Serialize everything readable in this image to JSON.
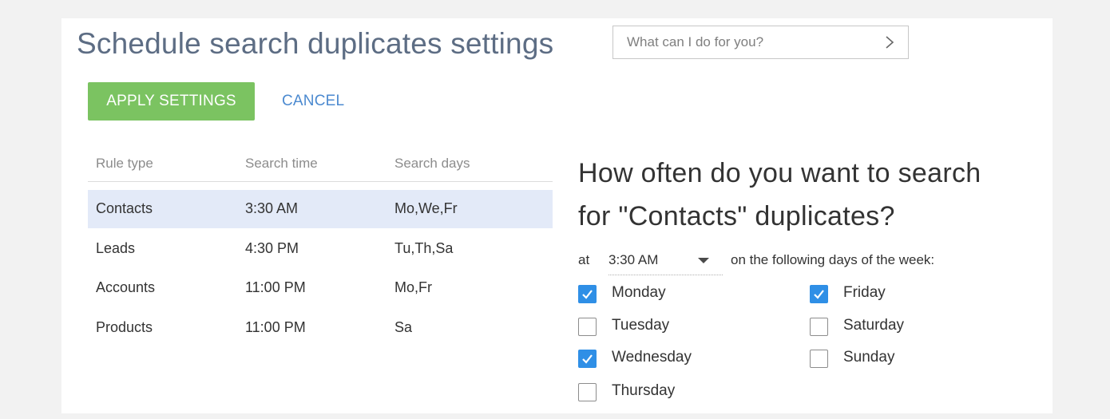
{
  "header": {
    "title": "Schedule search duplicates settings",
    "search_placeholder": "What can I do for you?"
  },
  "toolbar": {
    "apply_label": "APPLY SETTINGS",
    "cancel_label": "CANCEL"
  },
  "table": {
    "columns": [
      "Rule type",
      "Search time",
      "Search days"
    ],
    "rows": [
      {
        "rule_type": "Contacts",
        "search_time": "3:30 AM",
        "search_days": "Mo,We,Fr",
        "selected": true
      },
      {
        "rule_type": "Leads",
        "search_time": "4:30 PM",
        "search_days": "Tu,Th,Sa",
        "selected": false
      },
      {
        "rule_type": "Accounts",
        "search_time": "11:00 PM",
        "search_days": "Mo,Fr",
        "selected": false
      },
      {
        "rule_type": "Products",
        "search_time": "11:00 PM",
        "search_days": "Sa",
        "selected": false
      }
    ]
  },
  "schedule": {
    "question_line1": "How often do you want to search",
    "question_line2": "for \"Contacts\" duplicates?",
    "at_label": "at",
    "time_value": "3:30 AM",
    "days_label": "on the following days of the week:",
    "days": [
      {
        "label": "Monday",
        "checked": true
      },
      {
        "label": "Tuesday",
        "checked": false
      },
      {
        "label": "Wednesday",
        "checked": true
      },
      {
        "label": "Thursday",
        "checked": false
      },
      {
        "label": "Friday",
        "checked": true
      },
      {
        "label": "Saturday",
        "checked": false
      },
      {
        "label": "Sunday",
        "checked": false
      }
    ]
  },
  "colors": {
    "accent_green": "#7bc361",
    "link_blue": "#4c8ad0",
    "checkbox_blue": "#2f8fe6",
    "selected_row": "#e3eaf8",
    "title_gray": "#5d6d84"
  },
  "icons": {
    "search_submit": "chevron-right-icon",
    "time_dropdown": "chevron-down-icon",
    "checkbox_mark": "check-icon"
  }
}
